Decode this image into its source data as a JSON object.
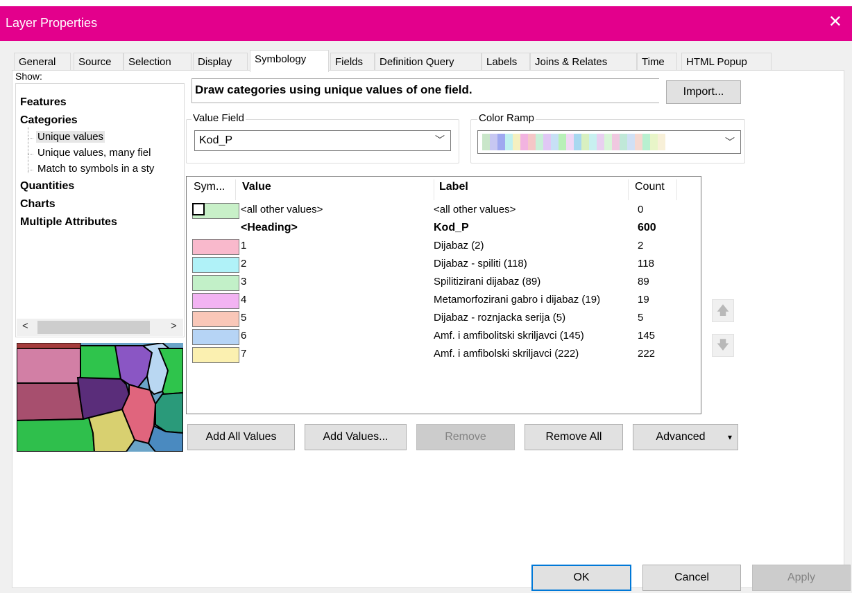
{
  "window": {
    "title": "Layer Properties",
    "close_icon": "close-icon"
  },
  "tabs": [
    {
      "label": "General"
    },
    {
      "label": "Source"
    },
    {
      "label": "Selection"
    },
    {
      "label": "Display"
    },
    {
      "label": "Symbology",
      "active": true
    },
    {
      "label": "Fields"
    },
    {
      "label": "Definition Query"
    },
    {
      "label": "Labels"
    },
    {
      "label": "Joins & Relates"
    },
    {
      "label": "Time"
    },
    {
      "label": "HTML Popup"
    }
  ],
  "show": {
    "label": "Show:",
    "items": [
      {
        "label": "Features"
      },
      {
        "label": "Categories"
      },
      {
        "label": "Unique values"
      },
      {
        "label": "Unique values, many fiel"
      },
      {
        "label": "Match to symbols in a sty"
      },
      {
        "label": "Quantities"
      },
      {
        "label": "Charts"
      },
      {
        "label": "Multiple Attributes"
      }
    ]
  },
  "description": "Draw categories using unique values of one field.",
  "import_label": "Import...",
  "value_field": {
    "label": "Value Field",
    "value": "Kod_P"
  },
  "color_ramp": {
    "label": "Color Ramp",
    "colors": [
      "#c9e6c9",
      "#c7c7f2",
      "#9fa8f0",
      "#c0f0f0",
      "#f5f0c0",
      "#f2b3e0",
      "#f5c7c7",
      "#c8f0d8",
      "#e0c8f5",
      "#c7e0f5",
      "#b8f0b8",
      "#f0d8f5",
      "#a8d8f0",
      "#d8f0c0",
      "#c8f0f0",
      "#e8d0f0",
      "#d8f5d8",
      "#f0c8e0",
      "#c0e8d8",
      "#d0e0f5",
      "#f5d8d0",
      "#b8f0d0",
      "#e8f5c8",
      "#f8f0d8"
    ]
  },
  "grid": {
    "headers": {
      "sym": "Sym...",
      "value": "Value",
      "label": "Label",
      "count": "Count"
    },
    "rows": [
      {
        "color": "#c8f0c8",
        "value": "<all other values>",
        "label": "<all other values>",
        "count": "0",
        "other": true
      },
      {
        "color": "",
        "value": "<Heading>",
        "label": "Kod_P",
        "count": "600",
        "heading": true
      },
      {
        "color": "#f9b9cc",
        "value": "1",
        "label": "Dijabaz (2)",
        "count": "2"
      },
      {
        "color": "#b0f2f8",
        "value": "2",
        "label": "Dijabaz - spiliti (118)",
        "count": "118"
      },
      {
        "color": "#c2f0c8",
        "value": "3",
        "label": "Spilitizirani dijabaz (89)",
        "count": "89"
      },
      {
        "color": "#f2b3f2",
        "value": "4",
        "label": "Metamorfozirani gabro i dijabaz (19)",
        "count": "19"
      },
      {
        "color": "#f9c7b8",
        "value": "5",
        "label": "Dijabaz - roznjacka serija (5)",
        "count": "5"
      },
      {
        "color": "#b6d4f5",
        "value": "6",
        "label": "Amf. i amfibolitski skriljavci (145)",
        "count": "145"
      },
      {
        "color": "#fbf0b0",
        "value": "7",
        "label": "Amf. i amfibolski skriljavci (222)",
        "count": "222"
      }
    ]
  },
  "buttons": {
    "add_all": "Add All Values",
    "add_values": "Add Values...",
    "remove": "Remove",
    "remove_all": "Remove All",
    "advanced": "Advanced",
    "ok": "OK",
    "cancel": "Cancel",
    "apply": "Apply"
  }
}
